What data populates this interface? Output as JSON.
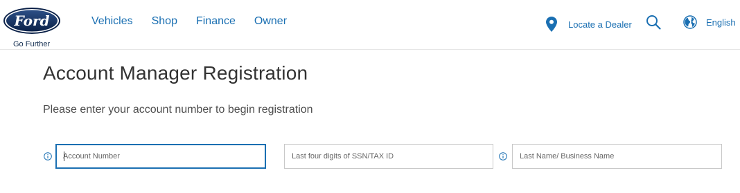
{
  "brand": {
    "logo_text": "Ford",
    "tagline": "Go Further",
    "colors": {
      "navy": "#102b4e",
      "accent": "#1a6fb2"
    }
  },
  "nav": {
    "items": [
      {
        "label": "Vehicles"
      },
      {
        "label": "Shop"
      },
      {
        "label": "Finance"
      },
      {
        "label": "Owner"
      }
    ]
  },
  "utility": {
    "dealer_label": "Locate a Dealer",
    "dealer_icon": "location-pin-icon",
    "search_icon": "search-icon",
    "language_label": "English",
    "language_icon": "globe-icon"
  },
  "main": {
    "title": "Account Manager Registration",
    "instructions": "Please enter your account number to begin registration",
    "fields": [
      {
        "placeholder": "Account Number",
        "value": "",
        "focused": true,
        "has_info": true
      },
      {
        "placeholder": "Last four digits of SSN/TAX ID",
        "value": "",
        "focused": false,
        "has_info": false
      },
      {
        "placeholder": "Last Name/ Business Name",
        "value": "",
        "focused": false,
        "has_info": true
      }
    ],
    "info_icon": "info-icon"
  }
}
